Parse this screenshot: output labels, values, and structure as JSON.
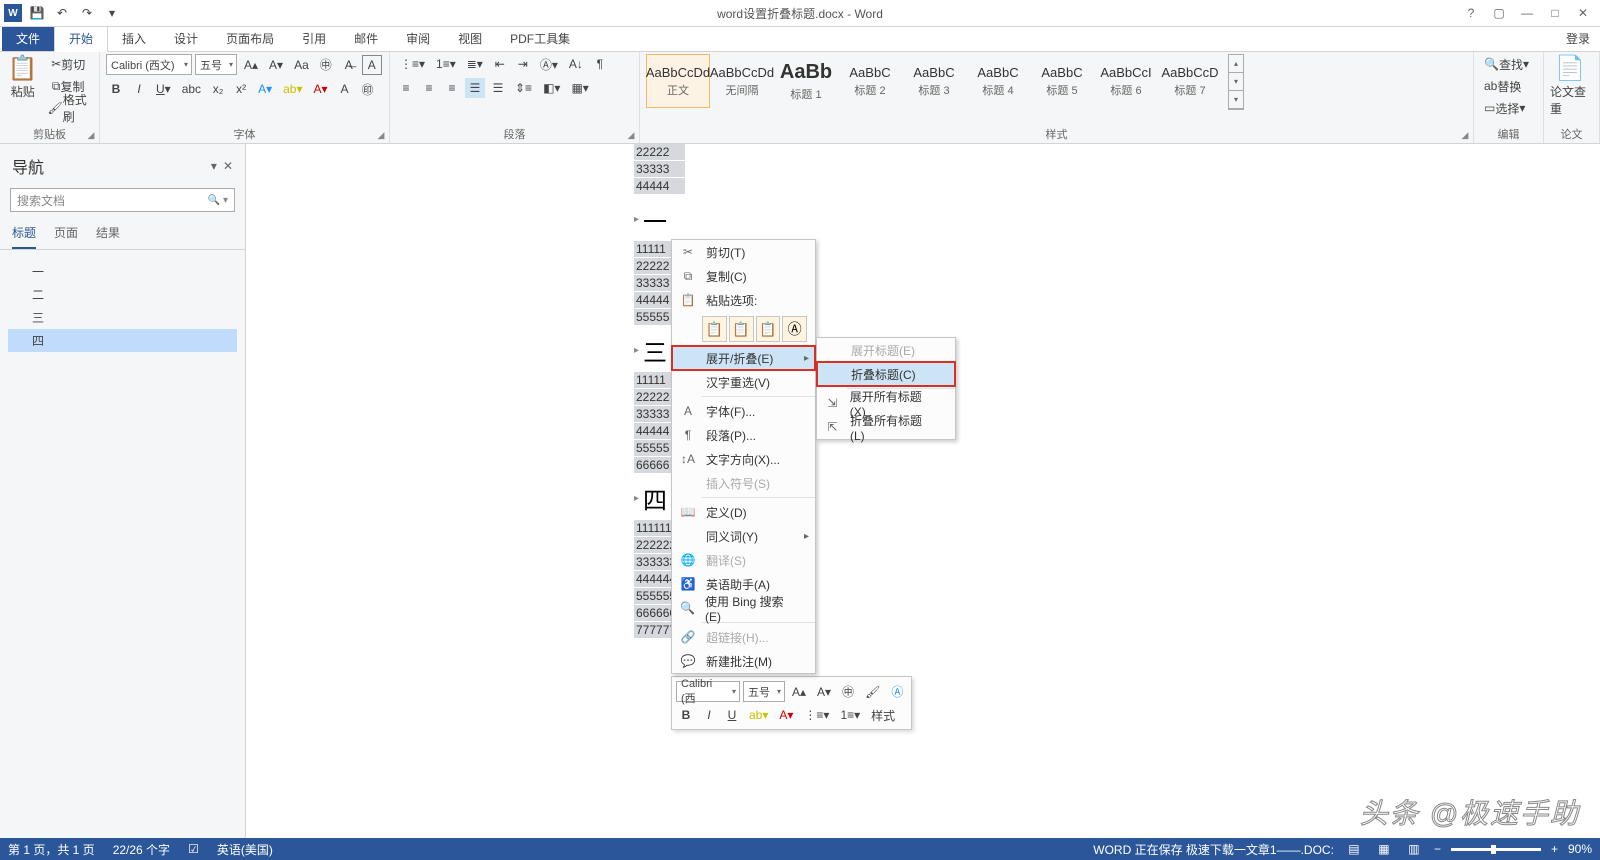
{
  "title": "word设置折叠标题.docx - Word",
  "qat": {
    "save": "💾",
    "undo": "↶",
    "redo": "↷"
  },
  "winbtns": {
    "help": "?",
    "ribbon": "▢",
    "min": "—",
    "max": "□",
    "close": "✕"
  },
  "login": "登录",
  "tabs": [
    "文件",
    "开始",
    "插入",
    "设计",
    "页面布局",
    "引用",
    "邮件",
    "审阅",
    "视图",
    "PDF工具集"
  ],
  "activeTab": "开始",
  "ribbon": {
    "clipboard": {
      "label": "剪贴板",
      "paste": "粘贴",
      "cut": "剪切",
      "copy": "复制",
      "painter": "格式刷"
    },
    "font": {
      "label": "字体",
      "name": "Calibri (西文)",
      "size": "五号"
    },
    "para": {
      "label": "段落"
    },
    "styles": {
      "label": "样式",
      "items": [
        {
          "prev": "AaBbCcDd",
          "name": "正文",
          "cls": ""
        },
        {
          "prev": "AaBbCcDd",
          "name": "无间隔",
          "cls": ""
        },
        {
          "prev": "AaBb",
          "name": "标题 1",
          "cls": "big"
        },
        {
          "prev": "AaBbC",
          "name": "标题 2",
          "cls": ""
        },
        {
          "prev": "AaBbC",
          "name": "标题 3",
          "cls": ""
        },
        {
          "prev": "AaBbC",
          "name": "标题 4",
          "cls": ""
        },
        {
          "prev": "AaBbC",
          "name": "标题 5",
          "cls": ""
        },
        {
          "prev": "AaBbCcI",
          "name": "标题 6",
          "cls": ""
        },
        {
          "prev": "AaBbCcD",
          "name": "标题 7",
          "cls": ""
        }
      ]
    },
    "edit": {
      "label": "编辑",
      "find": "查找",
      "replace": "替换",
      "select": "选择"
    },
    "paper": {
      "label": "论文",
      "btn": "论文查重"
    }
  },
  "nav": {
    "title": "导航",
    "placeholder": "搜索文档",
    "tabs": [
      "标题",
      "页面",
      "结果"
    ],
    "tree": [
      "一",
      "二",
      "三",
      "四"
    ],
    "selected": "四"
  },
  "doc": {
    "block1": [
      "22222",
      "33333",
      "44444"
    ],
    "h1": "一",
    "b1": [
      "11111",
      "22222",
      "33333",
      "44444",
      "55555"
    ],
    "h2": "三",
    "b2": [
      "11111",
      "22222",
      "33333",
      "44444",
      "55555",
      "66666"
    ],
    "h3": "四",
    "b3": [
      "1111111",
      "2222222",
      "3333333",
      "4444444",
      "5555555",
      "6666666",
      "7777777"
    ]
  },
  "ctx": {
    "cut": "剪切(T)",
    "copy": "复制(C)",
    "pasteOpt": "粘贴选项:",
    "expand": "展开/折叠(E)",
    "hanzi": "汉字重选(V)",
    "font": "字体(F)...",
    "para": "段落(P)...",
    "textdir": "文字方向(X)...",
    "symbol": "插入符号(S)",
    "define": "定义(D)",
    "synonym": "同义词(Y)",
    "translate": "翻译(S)",
    "english": "英语助手(A)",
    "bing": "使用 Bing 搜索(E)",
    "link": "超链接(H)...",
    "comment": "新建批注(M)"
  },
  "sub": {
    "expandH": "展开标题(E)",
    "collapseH": "折叠标题(C)",
    "expandAll": "展开所有标题(X)",
    "collapseAll": "折叠所有标题(L)"
  },
  "mini": {
    "font": "Calibri (西",
    "size": "五号",
    "styleBtn": "样式"
  },
  "status": {
    "page": "第 1 页，共 1 页",
    "words": "22/26 个字",
    "lang": "英语(美国)",
    "saving": "WORD 正在保存 极速下载一文章1——.DOC:",
    "zoom": "90%"
  },
  "watermark": "头条 @极速手助"
}
